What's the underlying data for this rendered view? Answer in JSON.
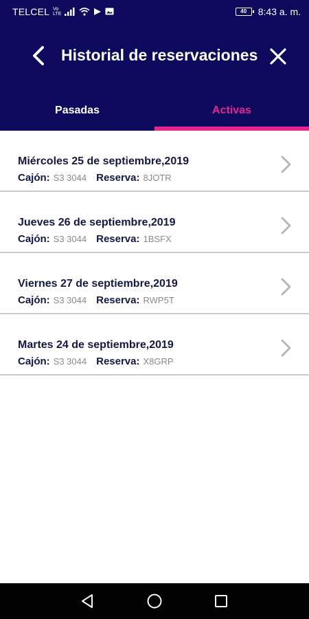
{
  "status_bar": {
    "carrier": "TELCEL",
    "volte_top": "Vo",
    "volte_bottom": "LTE",
    "battery": "40",
    "time": "8:43 a. m."
  },
  "header": {
    "title": "Historial de reservaciones"
  },
  "tabs": [
    {
      "label": "Pasadas",
      "active": false
    },
    {
      "label": "Activas",
      "active": true
    }
  ],
  "colors": {
    "header_bg": "#0d0a5e",
    "accent": "#e6238f"
  },
  "reservations": [
    {
      "date": "Miércoles 25 de septiembre,2019",
      "cajon_label": "Cajón:",
      "cajon": "S3 3044",
      "reserva_label": "Reserva:",
      "reserva": "8JOTR"
    },
    {
      "date": "Jueves 26 de septiembre,2019",
      "cajon_label": "Cajón:",
      "cajon": "S3 3044",
      "reserva_label": "Reserva:",
      "reserva": "1BSFX"
    },
    {
      "date": "Viernes 27 de septiembre,2019",
      "cajon_label": "Cajón:",
      "cajon": "S3 3044",
      "reserva_label": "Reserva:",
      "reserva": "RWP5T"
    },
    {
      "date": "Martes 24 de septiembre,2019",
      "cajon_label": "Cajón:",
      "cajon": "S3 3044",
      "reserva_label": "Reserva:",
      "reserva": "X8GRP"
    }
  ],
  "icons": {
    "back": "back-arrow-icon",
    "close": "close-icon",
    "chevron": "chevron-right-icon",
    "nav_back": "nav-back-icon",
    "nav_home": "nav-home-icon",
    "nav_recents": "nav-recents-icon"
  }
}
